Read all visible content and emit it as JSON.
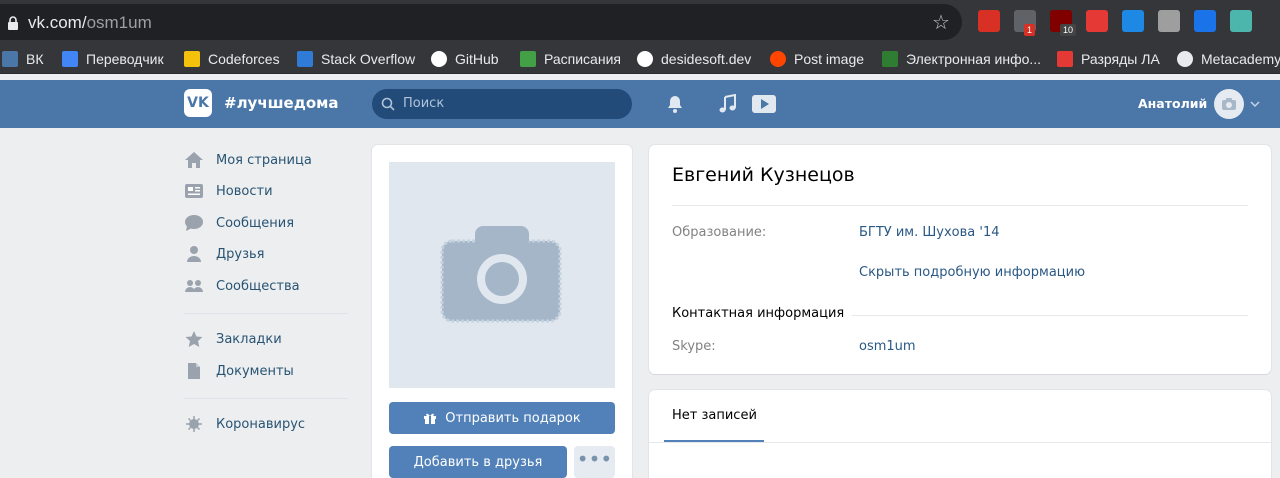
{
  "browser": {
    "url_host": "vk.com/",
    "url_path": "osm1um",
    "extensions": [
      {
        "name": "gmail-icon",
        "color": "#d93025",
        "badge": ""
      },
      {
        "name": "record-icon",
        "color": "#5f6368",
        "badge": "1"
      },
      {
        "name": "ublock-icon",
        "color": "#800000",
        "badge": "10"
      },
      {
        "name": "shield-icon",
        "color": "#e53935",
        "badge": ""
      },
      {
        "name": "skype-icon",
        "color": "#1e88e5",
        "badge": ""
      },
      {
        "name": "spy-icon",
        "color": "#9e9e9e",
        "badge": ""
      },
      {
        "name": "share-icon",
        "color": "#1a73e8",
        "badge": ""
      },
      {
        "name": "profile-icon",
        "color": "#4db6ac",
        "badge": ""
      }
    ]
  },
  "bookmarks": [
    {
      "label": "ВК",
      "icon": "vk-icon",
      "color": "#4a76a8"
    },
    {
      "label": "Переводчик",
      "icon": "translate-icon",
      "color": "#4285f4"
    },
    {
      "label": "Codeforces",
      "icon": "codeforces-icon",
      "color": "#f4c20d"
    },
    {
      "label": "Stack Overflow",
      "icon": "stackoverflow-icon",
      "color": "#2f7bd6"
    },
    {
      "label": "GitHub",
      "icon": "github-icon",
      "color": "#ffffff"
    },
    {
      "label": "Расписания",
      "icon": "schedule-icon",
      "color": "#43a047"
    },
    {
      "label": "desidesoft.dev",
      "icon": "google-icon",
      "color": "#ffffff"
    },
    {
      "label": "Post image",
      "icon": "reddit-icon",
      "color": "#ff4500"
    },
    {
      "label": "Электронная инфо...",
      "icon": "education-icon",
      "color": "#2e7d32"
    },
    {
      "label": "Разряды ЛА",
      "icon": "flag-icon",
      "color": "#e53935"
    },
    {
      "label": "Metacademy",
      "icon": "globe-icon",
      "color": "#e8eaed"
    }
  ],
  "header": {
    "logo": "VK",
    "slogan": "#лучшедома",
    "search_placeholder": "Поиск",
    "user_name": "Анатолий"
  },
  "menu": [
    {
      "label": "Моя страница",
      "icon": "home-icon"
    },
    {
      "label": "Новости",
      "icon": "news-icon"
    },
    {
      "label": "Сообщения",
      "icon": "messages-icon"
    },
    {
      "label": "Друзья",
      "icon": "friends-icon"
    },
    {
      "label": "Сообщества",
      "icon": "groups-icon"
    },
    {
      "label": "Закладки",
      "icon": "bookmarks-star-icon"
    },
    {
      "label": "Документы",
      "icon": "documents-icon"
    },
    {
      "label": "Коронавирус",
      "icon": "coronavirus-icon"
    }
  ],
  "profile": {
    "send_gift": "Отправить подарок",
    "add_friend": "Добавить в друзья",
    "more": "•••",
    "name": "Евгений Кузнецов",
    "education_label": "Образование:",
    "education_value": "БГТУ им. Шухова '14",
    "hide_details": "Скрыть подробную информацию",
    "contacts_title": "Контактная информация",
    "skype_label": "Skype:",
    "skype_value": "osm1um"
  },
  "wall": {
    "tab_label": "Нет записей"
  },
  "colors": {
    "vk_header": "#4a76a8",
    "vk_button": "#5181b8",
    "link": "#2a5885",
    "menu_text": "#285473"
  }
}
